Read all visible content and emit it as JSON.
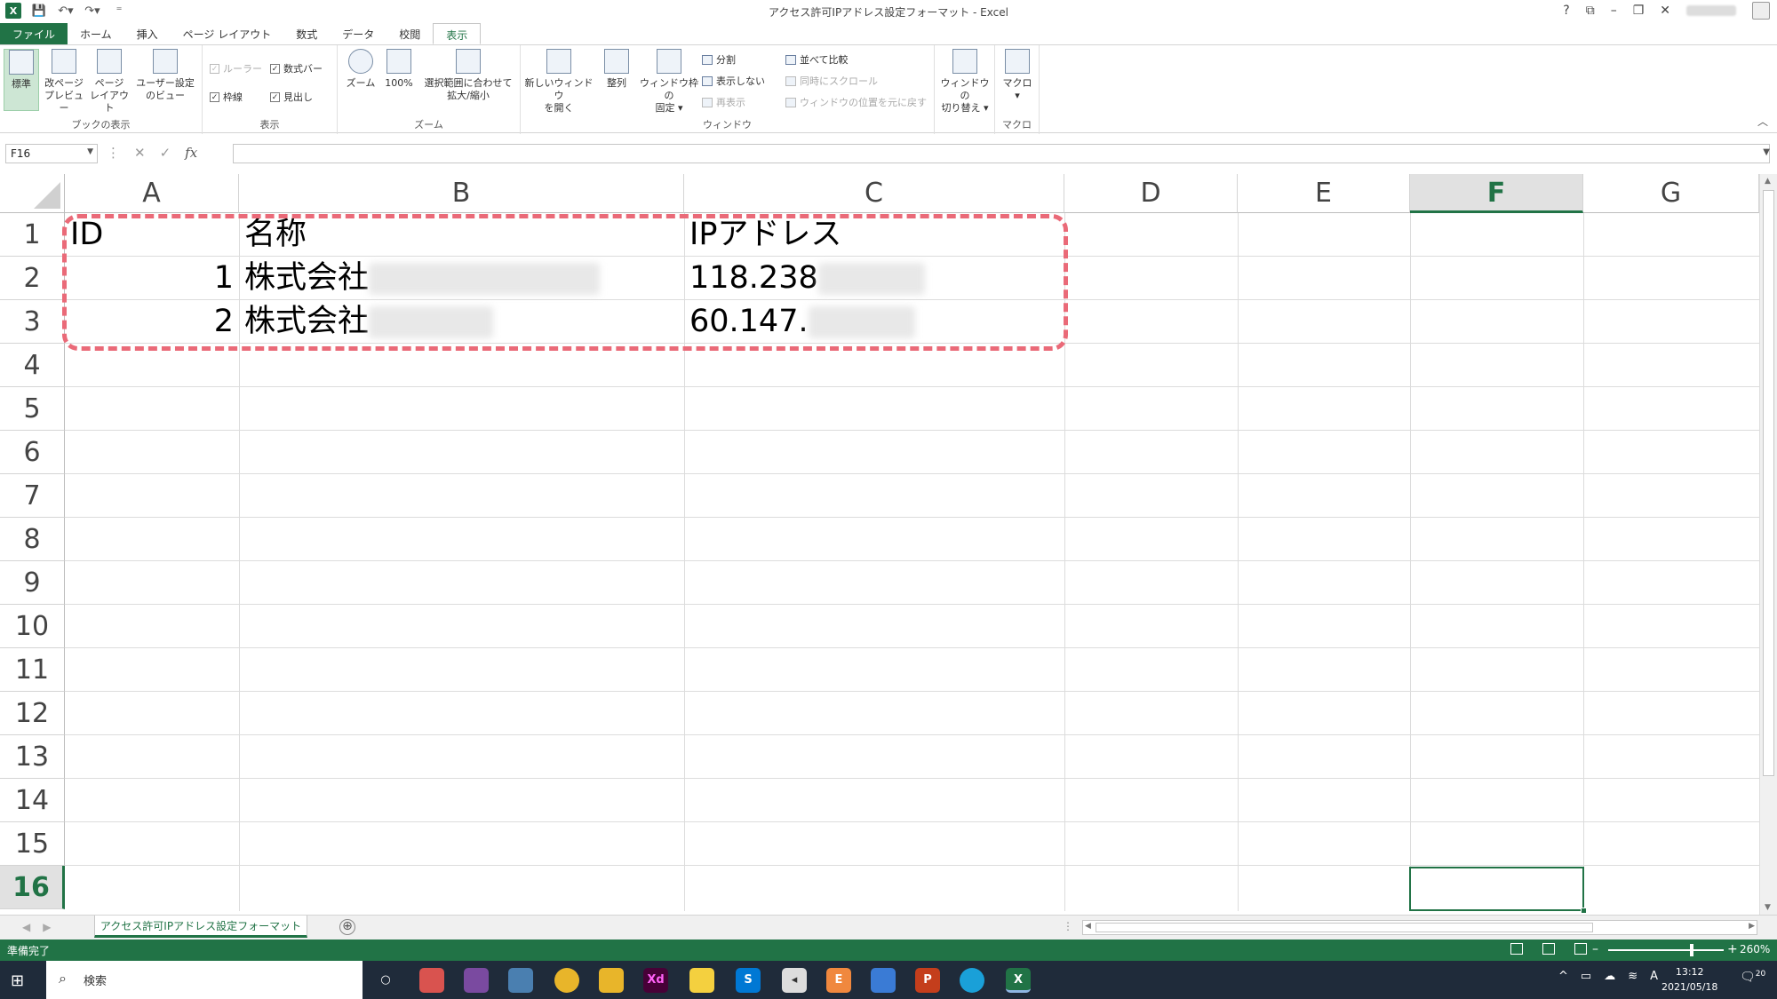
{
  "window": {
    "title": "アクセス許可IPアドレス設定フォーマット - Excel",
    "help": "?",
    "user_name": "",
    "qat_customize": "⁼"
  },
  "ribbon_tabs": [
    "ファイル",
    "ホーム",
    "挿入",
    "ページ レイアウト",
    "数式",
    "データ",
    "校閲",
    "表示"
  ],
  "ribbon": {
    "workbook_views": {
      "label": "ブックの表示",
      "buttons": [
        "標準",
        "改ページ\nプレビュー",
        "ページ\nレイアウト",
        "ユーザー設定\nのビュー"
      ]
    },
    "show": {
      "label": "表示",
      "ruler": "ルーラー",
      "formula_bar": "数式バー",
      "gridlines": "枠線",
      "headings": "見出し"
    },
    "zoom": {
      "label": "ズーム",
      "zoom": "ズーム",
      "hundred": "100%",
      "zoom_selection": "選択範囲に合わせて\n拡大/縮小"
    },
    "window": {
      "label": "ウィンドウ",
      "new_window": "新しいウィンドウ\nを開く",
      "arrange": "整列",
      "freeze": "ウィンドウ枠の\n固定 ▾",
      "split": "分割",
      "hide": "表示しない",
      "unhide": "再表示",
      "side_by_side": "並べて比較",
      "sync_scroll": "同時にスクロール",
      "reset_position": "ウィンドウの位置を元に戻す",
      "switch": "ウィンドウの\n切り替え ▾"
    },
    "macros": {
      "label": "マクロ",
      "macro": "マクロ\n▾"
    }
  },
  "formula_bar": {
    "name_box": "F16",
    "cancel": "✕",
    "enter": "✓",
    "fx": "fx",
    "value": ""
  },
  "columns": [
    "A",
    "B",
    "C",
    "D",
    "E",
    "F",
    "G"
  ],
  "rows": [
    "1",
    "2",
    "3",
    "4",
    "5",
    "6",
    "7",
    "8",
    "9",
    "10",
    "11",
    "12",
    "13",
    "14",
    "15",
    "16"
  ],
  "cells": {
    "A1": "ID",
    "B1": "名称",
    "C1": "IPアドレス",
    "A2": "1",
    "B2": "株式会社",
    "C2": "118.238",
    "A3": "2",
    "B3": "株式会社",
    "C3": "60.147."
  },
  "sheet_tab": "アクセス許可IPアドレス設定フォーマット",
  "add_sheet": "⊕",
  "status": {
    "text": "準備完了",
    "zoom": "260%",
    "zoom_level_percent": 260
  },
  "taskbar": {
    "search_label": "検索",
    "clock_time": "13:12",
    "clock_date": "2021/05/18",
    "ime": "A",
    "notifications": "20"
  },
  "colors": {
    "excel_green": "#217346",
    "annotation": "#ea6a78"
  }
}
